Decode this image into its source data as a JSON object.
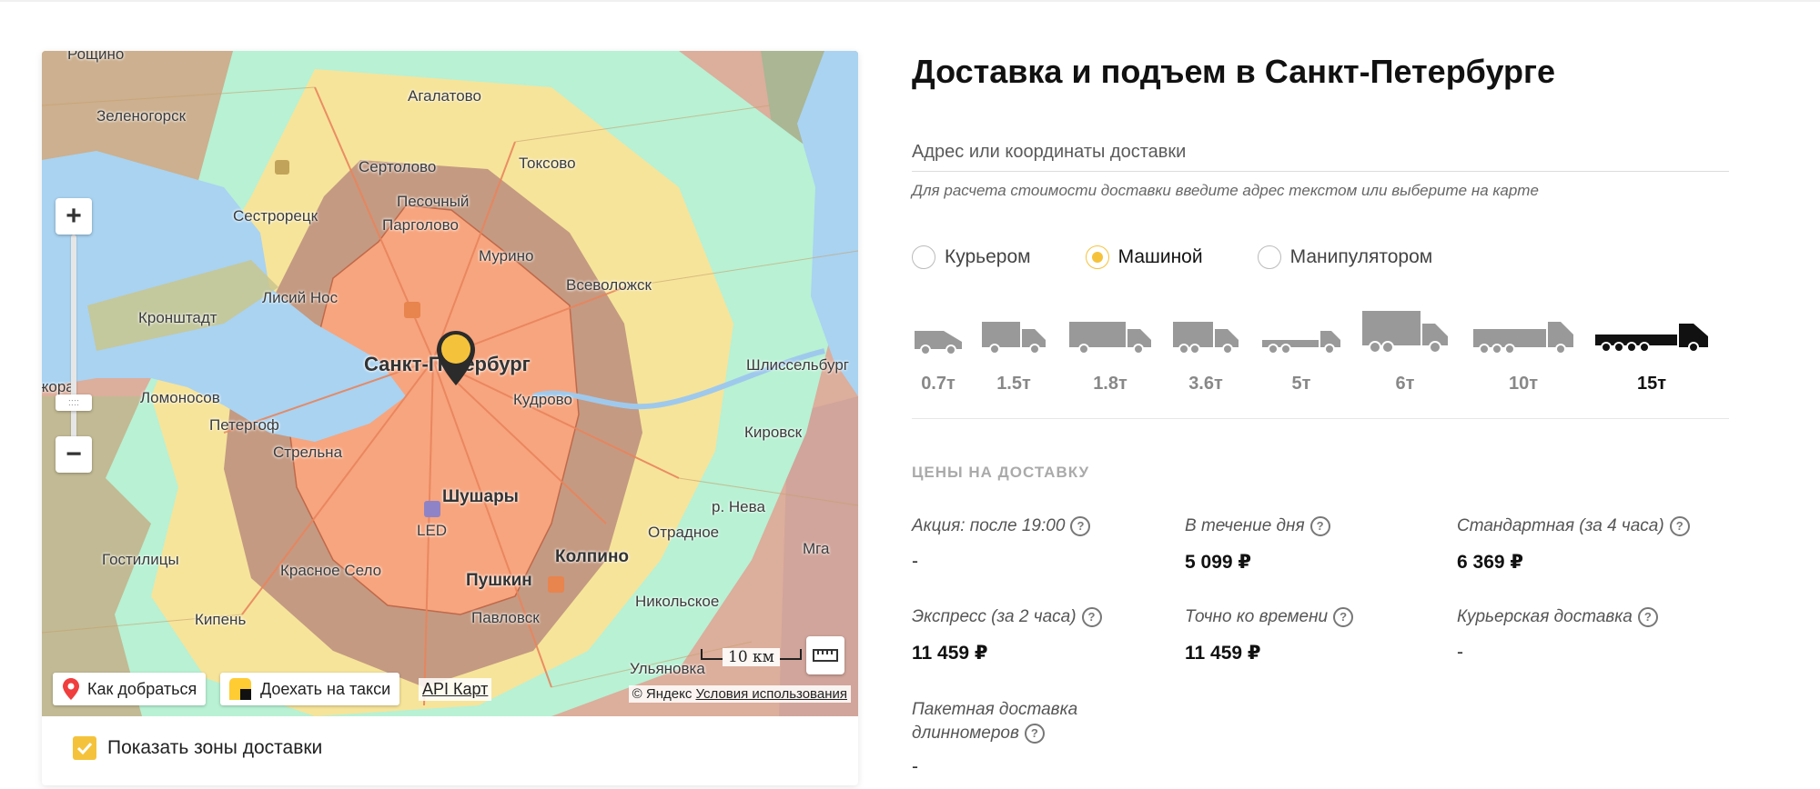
{
  "map": {
    "places": {
      "roshchino": "Рощино",
      "zelenogorsk": "Зеленогорск",
      "agalatovo": "Агалатово",
      "sertolovo": "Сертолово",
      "toksovo": "Токсово",
      "pesochny": "Песочный",
      "sestroretsk": "Сестрорецк",
      "pargolovo": "Парголово",
      "murino": "Мурино",
      "vsevolozhsk": "Всеволожск",
      "kronshtadt": "Кронштадт",
      "lisiy_nos": "Лисий Нос",
      "spb": "Санкт-Петербург",
      "shlisselburg": "Шлиссельбург",
      "kora": "жора",
      "lomonosov": "Ломоносов",
      "kudrovo": "Кудрово",
      "peterhof": "Петергоф",
      "strelna": "Стрельна",
      "kirovsk": "Кировск",
      "shushary": "Шушары",
      "led": "LED",
      "neva": "р. Нева",
      "otradnoe": "Отрадное",
      "mga": "Мга",
      "gostilitsy": "Гостилицы",
      "krasnoe_selo": "Красное Село",
      "pushkin": "Пушкин",
      "kolpino": "Колпино",
      "nikolskoe": "Никольское",
      "kipen": "Кипень",
      "pavlovsk": "Павловск",
      "ulyanovka": "Ульяновка"
    },
    "zoom_in": "+",
    "zoom_out": "−",
    "scale_label": "10 км",
    "route_button": "Как добраться",
    "taxi_button": "Доехать на такси",
    "api_link": "API Карт",
    "copyright_prefix": "© Яндекс",
    "terms_link": "Условия использования",
    "show_zones_label": "Показать зоны доставки",
    "show_zones_checked": true
  },
  "title": "Доставка и подъем в Санкт-Петербурге",
  "address": {
    "placeholder": "Адрес или координаты доставки",
    "value": ""
  },
  "hint": "Для расчета стоимости доставки введите адрес текстом или выберите на карте",
  "delivery_methods": [
    {
      "label": "Курьером",
      "selected": false
    },
    {
      "label": "Машиной",
      "selected": true
    },
    {
      "label": "Манипулятором",
      "selected": false
    }
  ],
  "trucks": [
    {
      "label": "0.7т",
      "selected": false
    },
    {
      "label": "1.5т",
      "selected": false
    },
    {
      "label": "1.8т",
      "selected": false
    },
    {
      "label": "3.6т",
      "selected": false
    },
    {
      "label": "5т",
      "selected": false
    },
    {
      "label": "6т",
      "selected": false
    },
    {
      "label": "10т",
      "selected": false
    },
    {
      "label": "15т",
      "selected": true
    }
  ],
  "prices_heading": "ЦЕНЫ НА ДОСТАВКУ",
  "prices": [
    {
      "label": "Акция: после 19:00",
      "value": "-"
    },
    {
      "label": "В течение дня",
      "value": "5 099 ₽"
    },
    {
      "label": "Стандартная (за 4 часа)",
      "value": "6 369 ₽"
    },
    {
      "label": "Экспресс (за 2 часа)",
      "value": "11 459 ₽"
    },
    {
      "label": "Точно ко времени",
      "value": "11 459 ₽"
    },
    {
      "label": "Курьерская доставка",
      "value": "-"
    },
    {
      "label": "Пакетная доставка длинномеров",
      "value": "-"
    }
  ],
  "help_icon": "?",
  "colors": {
    "accent": "#f5c33b",
    "zone_inner": "#f7a57e",
    "zone_brown": "#c49a82",
    "zone_yellow": "#f6e49a",
    "zone_green": "#b8f1d4",
    "zone_red": "#e8a8a0",
    "water": "#a9d3f1"
  }
}
